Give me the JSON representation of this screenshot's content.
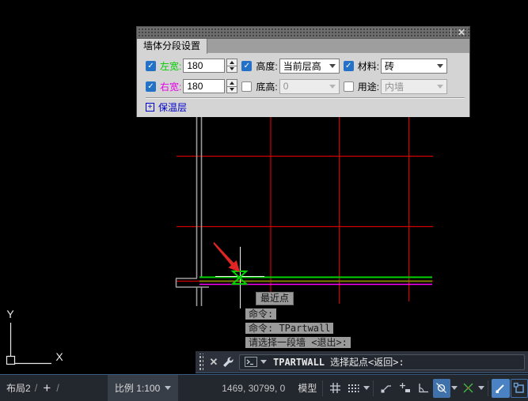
{
  "dialog": {
    "title": "墙体分段设置",
    "fields": {
      "left_width": {
        "label": "左宽:",
        "value": "180",
        "checked": true,
        "label_color": "#00cc00"
      },
      "right_width": {
        "label": "右宽:",
        "value": "180",
        "checked": true,
        "label_color": "#e800e8"
      },
      "height": {
        "label": "高度:",
        "value": "当前层高",
        "checked": true
      },
      "bottom_height": {
        "label": "底高:",
        "value": "0",
        "checked": false
      },
      "material": {
        "label": "材料:",
        "value": "砖",
        "checked": true
      },
      "usage": {
        "label": "用途:",
        "value": "内墙",
        "checked": false
      }
    },
    "insulation_label": "保温层"
  },
  "canvas": {
    "tooltip": "最近点",
    "history": [
      "命令:",
      "命令: TPartwall",
      "请选择一段墙 <退出>:"
    ],
    "ucs": {
      "x_label": "X",
      "y_label": "Y"
    }
  },
  "command_bar": {
    "command": "TPARTWALL",
    "prompt": "选择起点<返回>:"
  },
  "status_bar": {
    "layout_tab": "布局2",
    "slash": "/",
    "new_layout": "+",
    "scale": "比例 1:100",
    "coordinates": "1469, 30799, 0",
    "model": "模型"
  },
  "icons": {
    "close": "✕",
    "check": "✓",
    "expand_plus": "+"
  },
  "colors": {
    "checkbox_blue": "#2472c8",
    "left_width_green": "#00cc00",
    "right_width_magenta": "#e800e8",
    "link_blue": "#0000cc",
    "grid_red": "#d00000",
    "wall_highlight_green": "#00d400",
    "wall_highlight_magenta": "#ff00ff",
    "wall_baseline_olive": "#808000",
    "statusbar_active_blue": "#3f72ab"
  }
}
